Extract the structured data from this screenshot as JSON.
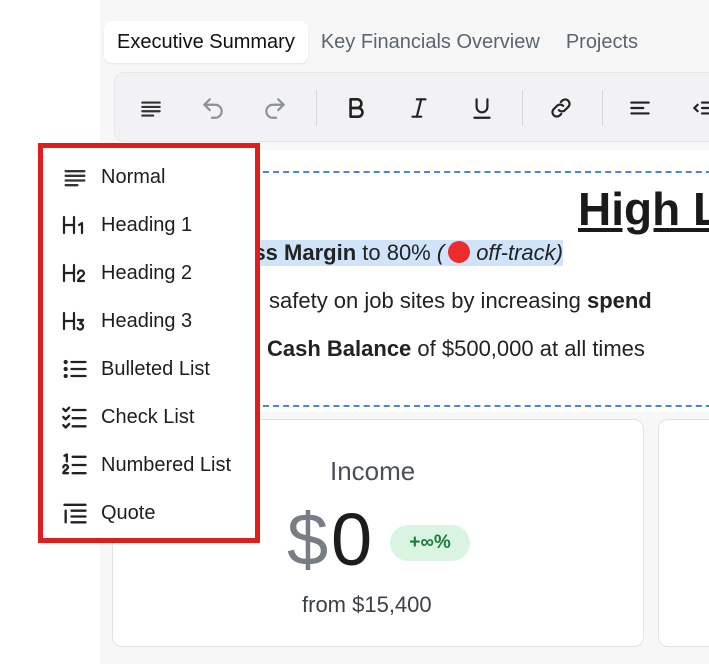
{
  "tabs": [
    {
      "label": "Executive Summary",
      "active": true
    },
    {
      "label": "Key Financials Overview",
      "active": false
    },
    {
      "label": "Projects",
      "active": false
    }
  ],
  "toolbar": {
    "icons": [
      "paragraph-style-icon",
      "undo-icon",
      "redo-icon",
      "bold-icon",
      "italic-icon",
      "underline-icon",
      "link-icon",
      "align-left-icon",
      "outdent-icon"
    ]
  },
  "document": {
    "title": "High L",
    "lines": [
      {
        "bold": "oss Margin",
        "rest": " to 80% ",
        "status": "off-track"
      },
      {
        "text": "safety on job sites by increasing ",
        "bold": "spend"
      },
      {
        "bold": "Cash Balance",
        "rest": " of $500,000 at all times"
      }
    ]
  },
  "income_card": {
    "title": "Income",
    "currency": "$",
    "amount": "0",
    "change": "+∞%",
    "from": "from $15,400"
  },
  "dropdown": {
    "items": [
      {
        "label": "Normal",
        "icon": "paragraph-lines-icon"
      },
      {
        "label": "Heading 1",
        "icon": "heading-1-icon"
      },
      {
        "label": "Heading 2",
        "icon": "heading-2-icon"
      },
      {
        "label": "Heading 3",
        "icon": "heading-3-icon"
      },
      {
        "label": "Bulleted List",
        "icon": "bullet-list-icon"
      },
      {
        "label": "Check List",
        "icon": "check-list-icon"
      },
      {
        "label": "Numbered List",
        "icon": "numbered-list-icon"
      },
      {
        "label": "Quote",
        "icon": "quote-icon"
      }
    ]
  },
  "colors": {
    "highlight": "#cfe3fb",
    "dropdown_border": "#e01c1c",
    "badge_bg": "#d9f5e1",
    "badge_text": "#1f7a3b",
    "status_dot": "#ee2c2c"
  }
}
